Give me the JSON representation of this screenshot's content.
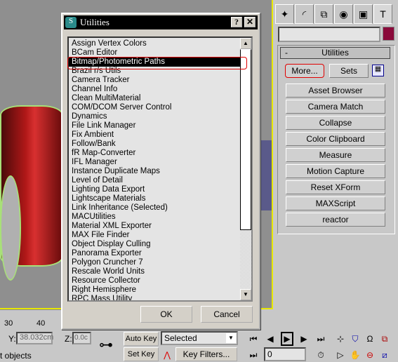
{
  "dialog": {
    "title": "Utilities",
    "help": "?",
    "close": "✕",
    "ok": "OK",
    "cancel": "Cancel",
    "items": [
      "Assign Vertex Colors",
      "BCam Editor",
      "Bitmap/Photometric Paths",
      "Brazil r/s Utils",
      "Camera Tracker",
      "Channel Info",
      "Clean MultiMaterial",
      "COM/DCOM Server Control",
      "Dynamics",
      "File Link Manager",
      "Fix Ambient",
      "Follow/Bank",
      "fR Map-Converter",
      "IFL Manager",
      "Instance Duplicate Maps",
      "Level of Detail",
      "Lighting Data Export",
      "Lightscape Materials",
      "Link Inheritance (Selected)",
      "MACUtilities",
      "Material XML Exporter",
      "MAX File Finder",
      "Object Display Culling",
      "Panorama Exporter",
      "Polygon Cruncher 7",
      "Rescale World Units",
      "Resource Collector",
      "Right Hemisphere",
      "RPC Mass Utility"
    ],
    "selected": "Bitmap/Photometric Paths"
  },
  "panel": {
    "color_swatch": "#8a0a3a",
    "rollout_title": "Utilities",
    "rollout_toggle": "-",
    "more": "More...",
    "sets": "Sets",
    "buttons": [
      "Asset Browser",
      "Camera Match",
      "Collapse",
      "Color Clipboard",
      "Measure",
      "Motion Capture",
      "Reset XForm",
      "MAXScript",
      "reactor"
    ]
  },
  "status": {
    "ruler_30": "30",
    "ruler_40": "40",
    "y_label": "Y:",
    "y_value": "38.032cm",
    "z_label": "Z:",
    "z_value": "0.0c",
    "prompt": "t objects",
    "auto_key": "Auto Key",
    "set_key": "Set Key",
    "selection": "Selected",
    "key_filters": "Key Filters...",
    "frame": "0"
  }
}
